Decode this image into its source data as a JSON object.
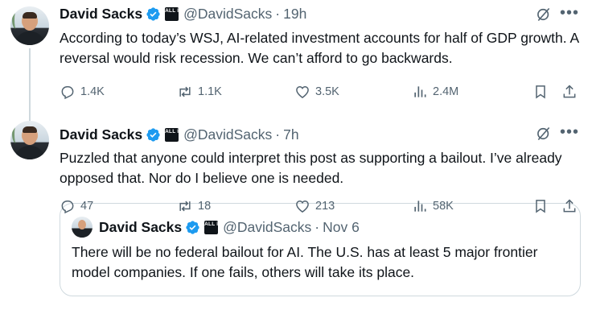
{
  "tweets": [
    {
      "author": {
        "name": "David Sacks",
        "badge_text": "ALL IN",
        "handle": "@DavidSacks",
        "time": "19h"
      },
      "text": "According to today’s WSJ, AI-related investment accounts for half of GDP growth. A reversal would risk recession. We can’t afford to go backwards.",
      "stats": {
        "replies": "1.4K",
        "reposts": "1.1K",
        "likes": "3.5K",
        "views": "2.4M"
      }
    },
    {
      "author": {
        "name": "David Sacks",
        "badge_text": "ALL IN",
        "handle": "@DavidSacks",
        "time": "7h"
      },
      "text": "Puzzled that anyone could interpret this post as supporting a bailout. I’ve already opposed that. Nor do I believe one is needed.",
      "quote": {
        "author": {
          "name": "David Sacks",
          "badge_text": "ALL IN",
          "handle": "@DavidSacks",
          "time": "Nov 6"
        },
        "text": "There will be no federal bailout for AI. The U.S. has at least 5 major frontier model companies. If one fails, others will take its place."
      },
      "stats": {
        "replies": "47",
        "reposts": "18",
        "likes": "213",
        "views": "58K"
      }
    }
  ],
  "separator": "·",
  "icons": {
    "verified": "verified-checkmark-icon",
    "grok": "grok-icon",
    "more": "more-dots-icon",
    "reply": "reply-icon",
    "repost": "repost-icon",
    "like": "heart-icon",
    "views": "views-icon",
    "bookmark": "bookmark-icon",
    "share": "share-icon"
  },
  "colors": {
    "verified_blue": "#1d9bf0",
    "text": "#0f1419",
    "secondary": "#536471",
    "border": "#cfd9de"
  }
}
